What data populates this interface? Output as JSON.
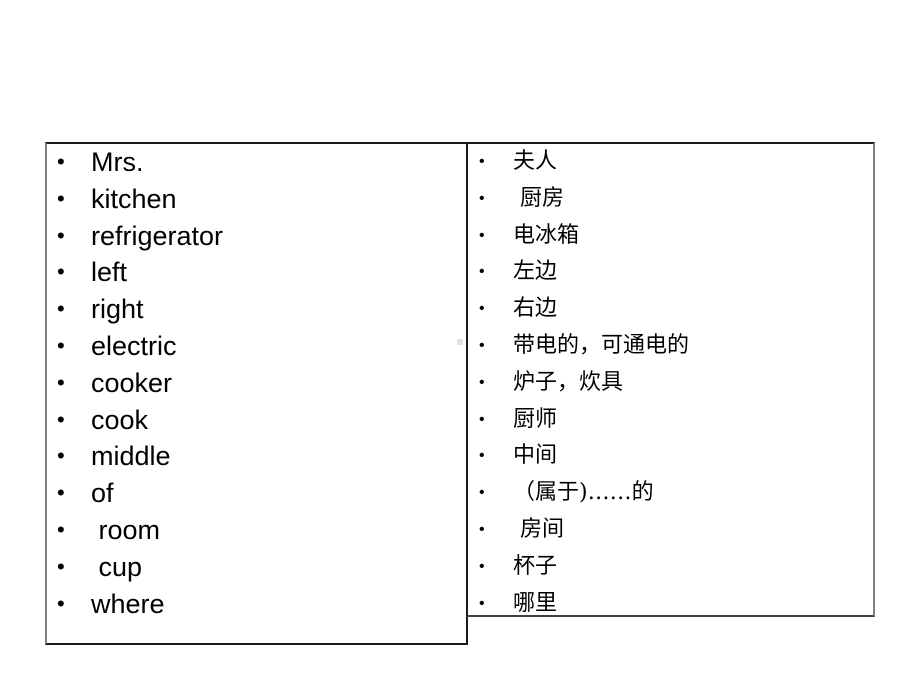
{
  "slide": {
    "english_words": [
      {
        "bullet": "•",
        "text": "Mrs."
      },
      {
        "bullet": "•",
        "text": "kitchen"
      },
      {
        "bullet": "•",
        "text": "refrigerator"
      },
      {
        "bullet": "•",
        "text": "left"
      },
      {
        "bullet": "•",
        "text": "right"
      },
      {
        "bullet": "•",
        "text": "electric"
      },
      {
        "bullet": "•",
        "text": "cooker"
      },
      {
        "bullet": "•",
        "text": "cook"
      },
      {
        "bullet": "•",
        "text": "middle"
      },
      {
        "bullet": "•",
        "text": "of"
      },
      {
        "bullet": "•",
        "text": " room"
      },
      {
        "bullet": "•",
        "text": " cup"
      },
      {
        "bullet": "•",
        "text": "where"
      }
    ],
    "chinese_meanings": [
      {
        "bullet": "•",
        "text": "夫人"
      },
      {
        "bullet": "•",
        "text": " 厨房"
      },
      {
        "bullet": "•",
        "text": "电冰箱"
      },
      {
        "bullet": "•",
        "text": "左边"
      },
      {
        "bullet": "•",
        "text": "右边"
      },
      {
        "bullet": "•",
        "text": "带电的，可通电的"
      },
      {
        "bullet": "•",
        "text": "炉子，炊具"
      },
      {
        "bullet": "•",
        "text": "厨师"
      },
      {
        "bullet": "•",
        "text": "中间"
      },
      {
        "bullet": "•",
        "text": "（属于)……的"
      },
      {
        "bullet": "•",
        "text": " 房间"
      },
      {
        "bullet": "•",
        "text": "杯子"
      },
      {
        "bullet": "•",
        "text": "哪里"
      }
    ]
  }
}
